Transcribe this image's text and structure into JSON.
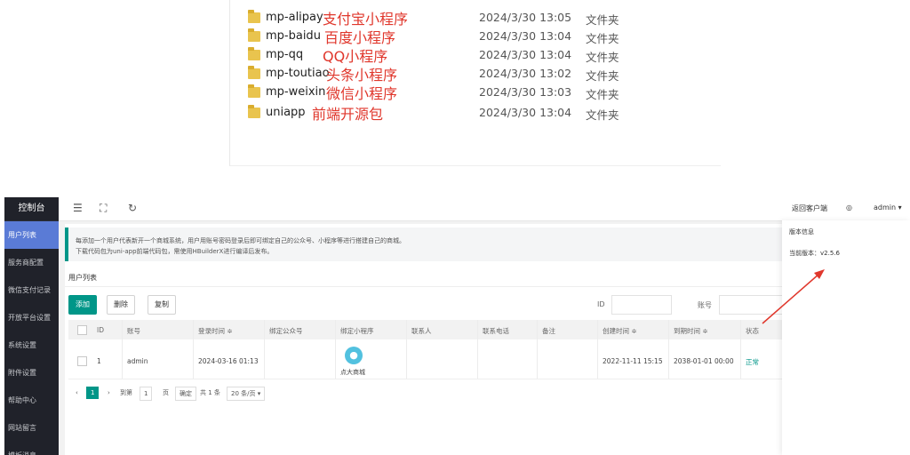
{
  "explorer": {
    "rows": [
      {
        "name": "mp-alipay",
        "note": "支付宝小程序",
        "date": "2024/3/30 13:05",
        "type": "文件夹"
      },
      {
        "name": "mp-baidu",
        "note": "百度小程序",
        "date": "2024/3/30 13:04",
        "type": "文件夹"
      },
      {
        "name": "mp-qq",
        "note": "QQ小程序",
        "date": "2024/3/30 13:04",
        "type": "文件夹"
      },
      {
        "name": "mp-toutiao",
        "note": "头条小程序",
        "date": "2024/3/30 13:02",
        "type": "文件夹"
      },
      {
        "name": "mp-weixin",
        "note": "微信小程序",
        "date": "2024/3/30 13:03",
        "type": "文件夹"
      },
      {
        "name": "uniapp",
        "note": "前端开源包",
        "date": "2024/3/30 13:04",
        "type": "文件夹"
      }
    ]
  },
  "sidebar": {
    "title": "控制台",
    "items": [
      "用户列表",
      "服务商配置",
      "微信支付记录",
      "开放平台设置",
      "系统设置",
      "附件设置",
      "帮助中心",
      "网站留言",
      "模板消息"
    ]
  },
  "topbar": {
    "back_label": "返回客户端",
    "user_label": "admin ▾"
  },
  "notice": {
    "line1": "每添加一个用户代表新开一个商城系统，用户用账号密码登录后即可绑定自己的公众号、小程序等进行搭建自己的商城。",
    "line2": "下载代码包为uni-app前端代码包，需使用HBuilderX进行编译后发布。"
  },
  "list": {
    "title": "用户列表",
    "buttons": {
      "add": "添加",
      "delete": "删除",
      "copy": "复制"
    },
    "filters": {
      "id_label": "ID",
      "account_label": "账号"
    },
    "columns": [
      "ID",
      "账号",
      "登录时间 ≑",
      "绑定公众号",
      "绑定小程序",
      "联系人",
      "联系电话",
      "备注",
      "创建时间 ≑",
      "到期时间 ≑",
      "状态"
    ],
    "row": {
      "id": "1",
      "account": "admin",
      "login_time": "2024-03-16 01:13",
      "mini_program": "点大商城",
      "created": "2022-11-11 15:15",
      "expires": "2038-01-01 00:00",
      "status": "正常"
    },
    "pager": {
      "prev": "‹",
      "current": "1",
      "next": "›",
      "goto": "到第",
      "page_input": "1",
      "page_unit": "页",
      "confirm": "确定",
      "total": "共 1 条",
      "per_page": "20 条/页 ▾"
    }
  },
  "version": {
    "title": "版本信息",
    "current": "当前版本：v2.5.6"
  },
  "colors": {
    "accent": "#009688",
    "sidebar": "#20222a",
    "note_red": "#e0372c"
  }
}
